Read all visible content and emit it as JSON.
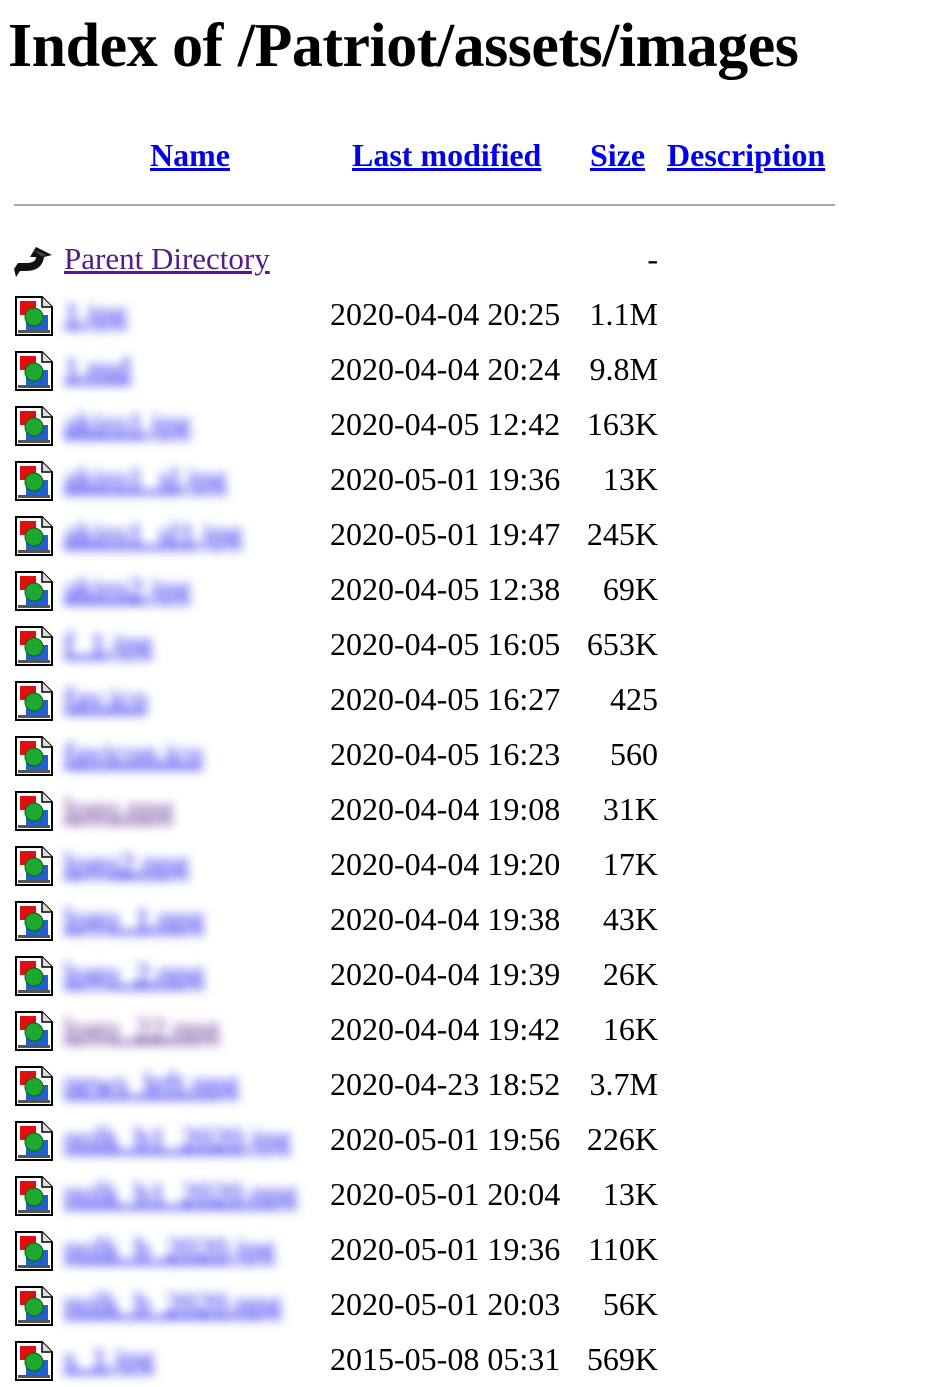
{
  "page": {
    "title": "Index of /Patriot/assets/images"
  },
  "columns": {
    "name": "Name",
    "last_modified": "Last modified",
    "size": "Size",
    "description": "Description"
  },
  "parent": {
    "label": "Parent Directory",
    "size": "-",
    "icon": "back-arrow-icon"
  },
  "files": [
    {
      "name": "1.jpg",
      "date": "2020-04-04 20:25",
      "size": "1.1M",
      "visited": false
    },
    {
      "name": "1.psd",
      "date": "2020-04-04 20:24",
      "size": "9.8M",
      "visited": false
    },
    {
      "name": "akiro1.jpg",
      "date": "2020-04-05 12:42",
      "size": "163K",
      "visited": false
    },
    {
      "name": "akiro1_sl.jpg",
      "date": "2020-05-01 19:36",
      "size": "13K",
      "visited": false
    },
    {
      "name": "akiro1_sl1.jpg",
      "date": "2020-05-01 19:47",
      "size": "245K",
      "visited": false
    },
    {
      "name": "akiro2.jpg",
      "date": "2020-04-05 12:38",
      "size": "69K",
      "visited": false
    },
    {
      "name": "f_1.jpg",
      "date": "2020-04-05 16:05",
      "size": "653K",
      "visited": false
    },
    {
      "name": "fav.ico",
      "date": "2020-04-05 16:27",
      "size": "425",
      "visited": false
    },
    {
      "name": "favicon.ico",
      "date": "2020-04-05 16:23",
      "size": "560",
      "visited": false
    },
    {
      "name": "logo.png",
      "date": "2020-04-04 19:08",
      "size": "31K",
      "visited": true
    },
    {
      "name": "logo2.png",
      "date": "2020-04-04 19:20",
      "size": "17K",
      "visited": false
    },
    {
      "name": "logo_1.png",
      "date": "2020-04-04 19:38",
      "size": "43K",
      "visited": false
    },
    {
      "name": "logo_2.png",
      "date": "2020-04-04 19:39",
      "size": "26K",
      "visited": false
    },
    {
      "name": "logo_22.png",
      "date": "2020-04-04 19:42",
      "size": "16K",
      "visited": true
    },
    {
      "name": "news_left.png",
      "date": "2020-04-23 18:52",
      "size": "3.7M",
      "visited": false
    },
    {
      "name": "polk_b1_2020.jpg",
      "date": "2020-05-01 19:56",
      "size": "226K",
      "visited": false
    },
    {
      "name": "polk_b1_2020.png",
      "date": "2020-05-01 20:04",
      "size": "13K",
      "visited": false
    },
    {
      "name": "polk_b_2020.jpg",
      "date": "2020-05-01 19:36",
      "size": "110K",
      "visited": false
    },
    {
      "name": "polk_b_2020.png",
      "date": "2020-05-01 20:03",
      "size": "56K",
      "visited": false
    },
    {
      "name": "s_1.jpg",
      "date": "2015-05-08 05:31",
      "size": "569K",
      "visited": false
    }
  ],
  "file_icon": "image-file-icon"
}
